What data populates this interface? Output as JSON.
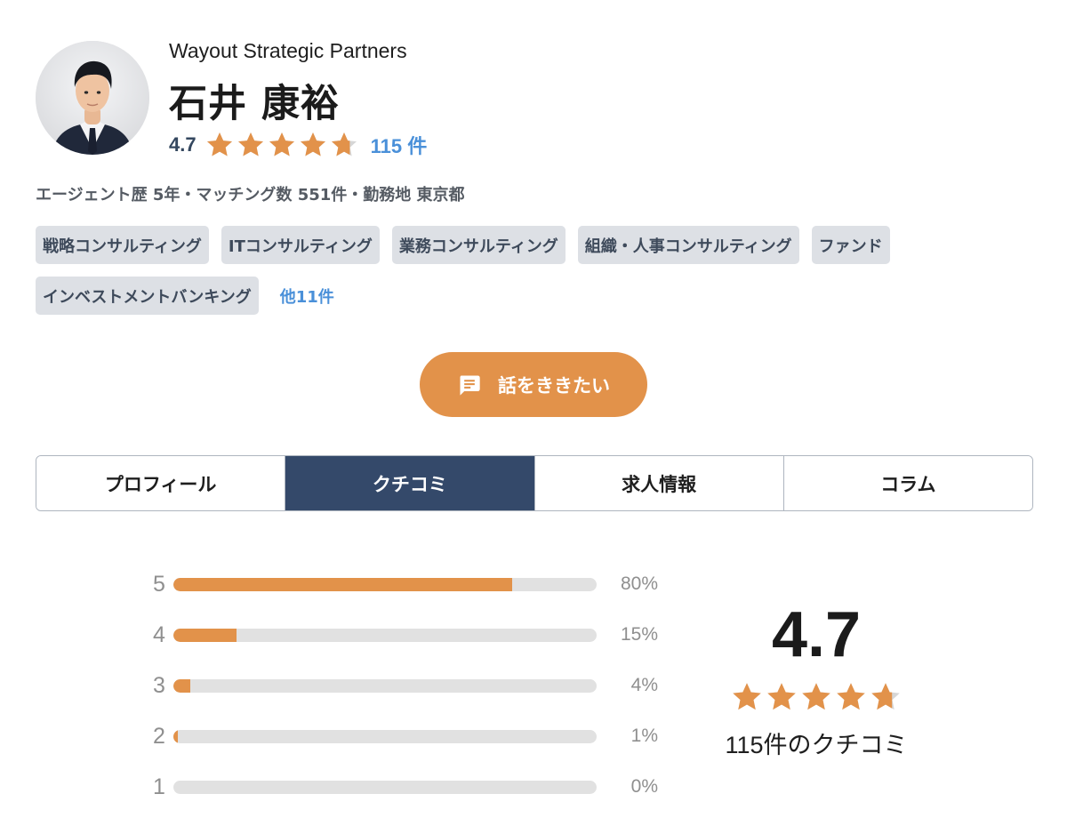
{
  "agent": {
    "company": "Wayout Strategic Partners",
    "name": "石井 康裕",
    "rating": "4.7",
    "rating_value": 4.7,
    "review_count": "115 件",
    "meta": "エージェント歴 5年・マッチング数 551件・勤務地 東京都"
  },
  "tags": [
    "戦略コンサルティング",
    "ITコンサルティング",
    "業務コンサルティング",
    "組織・人事コンサルティング",
    "ファンド",
    "インベストメントバンキング"
  ],
  "tags_more": "他11件",
  "cta": {
    "label": "話をききたい",
    "icon": "chat-bubble-icon"
  },
  "tabs": [
    {
      "label": "プロフィール",
      "active": false
    },
    {
      "label": "クチコミ",
      "active": true
    },
    {
      "label": "求人情報",
      "active": false
    },
    {
      "label": "コラム",
      "active": false
    }
  ],
  "reviews": {
    "distribution": [
      {
        "star": "5",
        "percent": "80%",
        "value": 80
      },
      {
        "star": "4",
        "percent": "15%",
        "value": 15
      },
      {
        "star": "3",
        "percent": "4%",
        "value": 4
      },
      {
        "star": "2",
        "percent": "1%",
        "value": 1
      },
      {
        "star": "1",
        "percent": "0%",
        "value": 0
      }
    ],
    "average": "4.7",
    "average_value": 4.7,
    "total_label": "115件のクチコミ"
  },
  "colors": {
    "accent": "#e2924a",
    "navy": "#34496a",
    "link": "#4a90d9",
    "star_empty": "#d6d6d6",
    "tag_bg": "#dde0e5"
  }
}
